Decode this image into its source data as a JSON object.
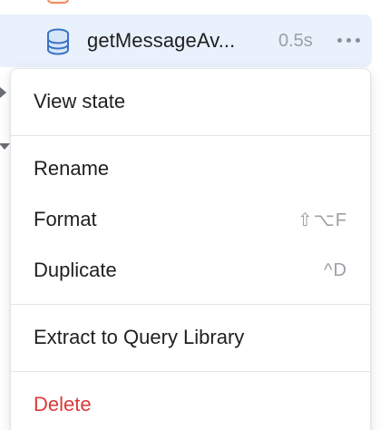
{
  "query": {
    "name": "getMessageAv...",
    "duration": "0.5s",
    "icon": "database-icon",
    "more_icon": "more-horizontal-icon"
  },
  "context_menu": {
    "items": [
      {
        "label": "View state",
        "shortcut": ""
      },
      {
        "label": "Rename",
        "shortcut": ""
      },
      {
        "label": "Format",
        "shortcut": "⇧⌥F"
      },
      {
        "label": "Duplicate",
        "shortcut": "^D"
      },
      {
        "label": "Extract to Query Library",
        "shortcut": ""
      },
      {
        "label": "Delete",
        "shortcut": ""
      }
    ]
  },
  "colors": {
    "selected_row_bg": "#e8f1fc",
    "database_icon": "#3b72c4",
    "danger": "#d93a3a",
    "muted_text": "#9aa0a6"
  }
}
